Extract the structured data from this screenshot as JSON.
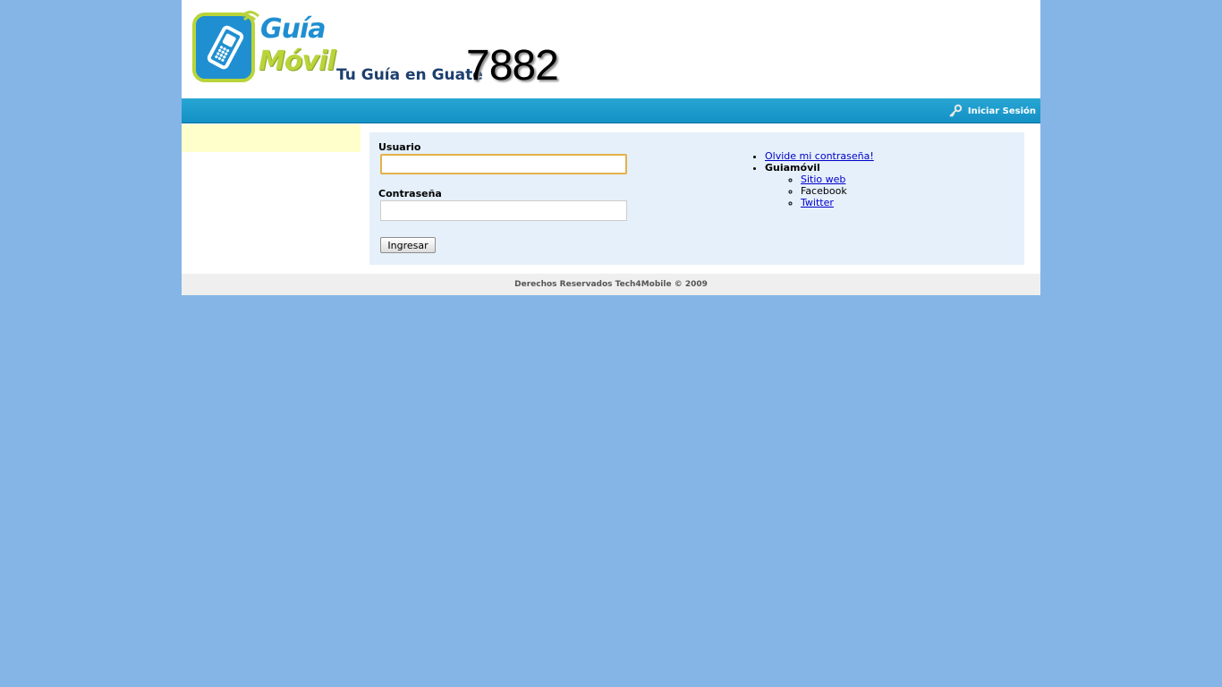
{
  "header": {
    "logo_line1": "Guía",
    "logo_line2": "Móvil",
    "tagline": "Tu Guía en Guate",
    "tagline_number": "7882"
  },
  "navbar": {
    "login_label": "Iniciar Sesión"
  },
  "form": {
    "username_label": "Usuario",
    "username_value": "",
    "password_label": "Contraseña",
    "password_value": "",
    "submit_label": "Ingresar"
  },
  "links": {
    "forgot_password": "Olvide mi contraseña!",
    "section_title": "Guiamóvil",
    "sub_items": [
      "Sitio web",
      "Facebook",
      "Twitter"
    ]
  },
  "footer": {
    "copyright": "Derechos Reservados Tech4Mobile © 2009"
  },
  "colors": {
    "background": "#84b5e6",
    "navbar": "#1d9bcc",
    "content_bg": "#e5f0fa",
    "sidebar_bg": "#ffffcc",
    "logo_blue": "#1f8fd1",
    "logo_green": "#b8d43a"
  },
  "icons": {
    "navbar_login": "key-icon"
  }
}
